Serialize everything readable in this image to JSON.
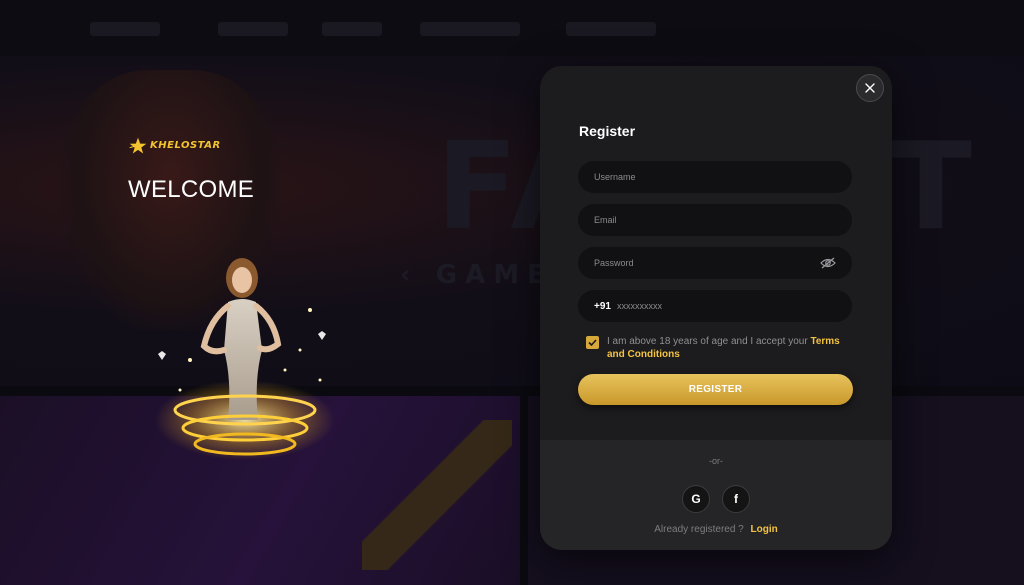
{
  "brand": {
    "logo_text": "KHELOSTAR"
  },
  "welcome": {
    "heading": "WELCOME"
  },
  "modal": {
    "title": "Register",
    "fields": {
      "username_placeholder": "Username",
      "email_placeholder": "Email",
      "password_placeholder": "Password",
      "phone_country_code": "+91",
      "phone_placeholder": "xxxxxxxxxx"
    },
    "terms": {
      "checked": true,
      "text": "I am above 18 years of age and I accept your",
      "link": "Terms and Conditions"
    },
    "register_button": "REGISTER",
    "or_text": "-or-",
    "social": {
      "google": "G",
      "facebook": "f"
    },
    "already_text": "Already registered ?",
    "login_link": "Login"
  },
  "colors": {
    "accent": "#f3c340",
    "button_gold_top": "#e7c35c",
    "button_gold_bottom": "#c9982b",
    "modal_bg": "#1c1c1e",
    "field_bg": "#111113"
  },
  "icons": [
    "close-icon",
    "eye-off-icon",
    "checkmark-icon",
    "google-icon",
    "facebook-icon",
    "star-logo-icon"
  ]
}
